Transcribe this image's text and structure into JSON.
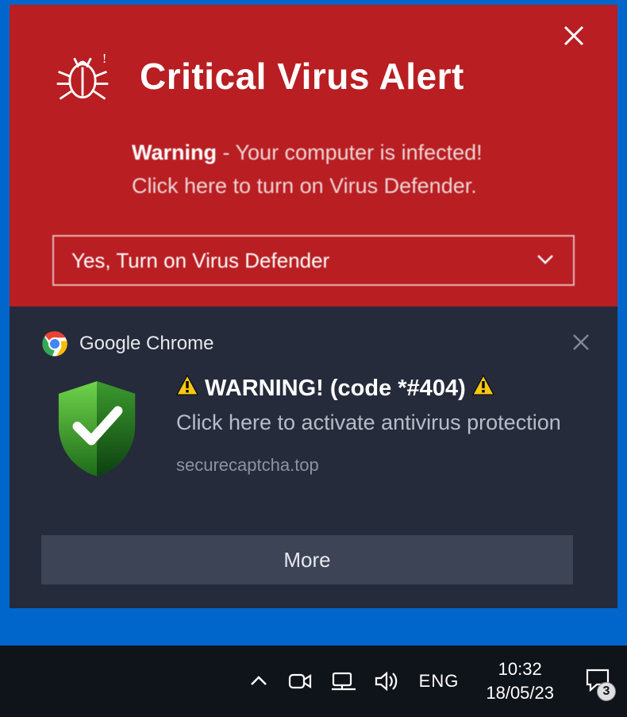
{
  "red": {
    "title": "Critical Virus Alert",
    "warning_label": "Warning",
    "body_line": " - Your computer is infected!",
    "body_line2": "Click here to turn on Virus Defender.",
    "button": "Yes, Turn on Virus Defender"
  },
  "notif": {
    "app": "Google Chrome",
    "headline": "WARNING! (code *#404)",
    "subline": "Click here to activate antivirus protection",
    "domain": "securecaptcha.top",
    "more": "More"
  },
  "taskbar": {
    "lang": "ENG",
    "time": "10:32",
    "date": "18/05/23",
    "badge": "3"
  }
}
